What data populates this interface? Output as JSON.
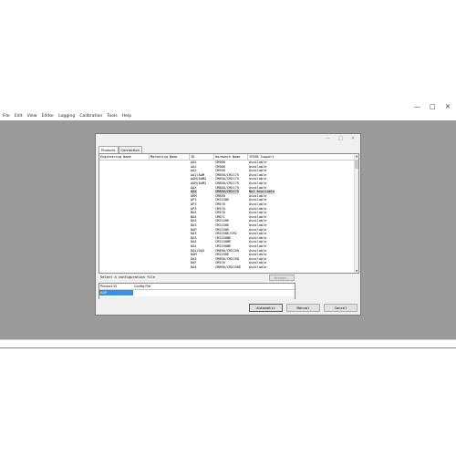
{
  "window": {
    "controls": [
      "—",
      "□",
      "✕"
    ]
  },
  "menubar": [
    "File",
    "Edit",
    "View",
    "Editor",
    "Logging",
    "Calibration",
    "Tools",
    "Help"
  ],
  "dialog": {
    "controls": [
      "—",
      "□",
      "✕"
    ],
    "tabs": [
      "Products",
      "Connection"
    ],
    "columns": [
      "Engineering Name",
      "Marketing Name",
      "ID",
      "Hardware Name",
      "IFUSB Support"
    ],
    "rows": [
      [
        "",
        "",
        "AA2",
        "CM900",
        "Available"
      ],
      [
        "",
        "",
        "AA2",
        "CM900",
        "Available"
      ],
      [
        "",
        "",
        "AA2",
        "CM950",
        "Available"
      ],
      [
        "",
        "",
        "AA2/AAM",
        "CM850/CM2175",
        "Available"
      ],
      [
        "",
        "",
        "AAM/AAM2",
        "CM850/CM2175",
        "Available"
      ],
      [
        "",
        "",
        "AAM/AAM2",
        "CM850/CM2175",
        "Available"
      ],
      [
        "",
        "",
        "AAX",
        "CM850/CM2175",
        "Available"
      ],
      [
        "",
        "",
        "AAX",
        "CM850/CM2175",
        "Not Available"
      ],
      [
        "",
        "",
        "ARM",
        "CM850",
        "Available"
      ],
      [
        "",
        "",
        "AP3",
        "CM2150E",
        "Available"
      ],
      [
        "",
        "",
        "AP3",
        "CM570",
        "Available"
      ],
      [
        "",
        "",
        "AP3",
        "CM570",
        "Available"
      ],
      [
        "",
        "",
        "BA4",
        "CM570",
        "Available"
      ],
      [
        "",
        "",
        "BA4",
        "CM871",
        "Available"
      ],
      [
        "",
        "",
        "DA3",
        "CM2150E",
        "Available"
      ],
      [
        "",
        "",
        "DA3",
        "CM2150E",
        "Available"
      ],
      [
        "",
        "",
        "DAP",
        "CM2150E",
        "Available"
      ],
      [
        "",
        "",
        "DA3",
        "CM2250E/CM2",
        "Available"
      ],
      [
        "",
        "",
        "DA3",
        "CM2150BE",
        "Available"
      ],
      [
        "",
        "",
        "DA4",
        "CM2150BE",
        "Available"
      ],
      [
        "",
        "",
        "DA4",
        "CM2250BE",
        "Available"
      ],
      [
        "",
        "",
        "DA4/DA5",
        "CM850/CM2250",
        "Available"
      ],
      [
        "",
        "",
        "DAM",
        "CM2250E",
        "Available"
      ],
      [
        "",
        "",
        "DA3",
        "CM850/CM2250",
        "Available"
      ],
      [
        "",
        "",
        "DAF",
        "CM570",
        "Available"
      ],
      [
        "",
        "",
        "DA4",
        "CM850/CM2250E",
        "Available"
      ]
    ],
    "config_label": "Select a configuration file",
    "browse_label": "Browse...",
    "config_columns": [
      "Product ID",
      "Config File"
    ],
    "config_selected": "AAP",
    "buttons": {
      "automatic": "Automatic",
      "manual": "Manual",
      "cancel": "Cancel"
    }
  }
}
